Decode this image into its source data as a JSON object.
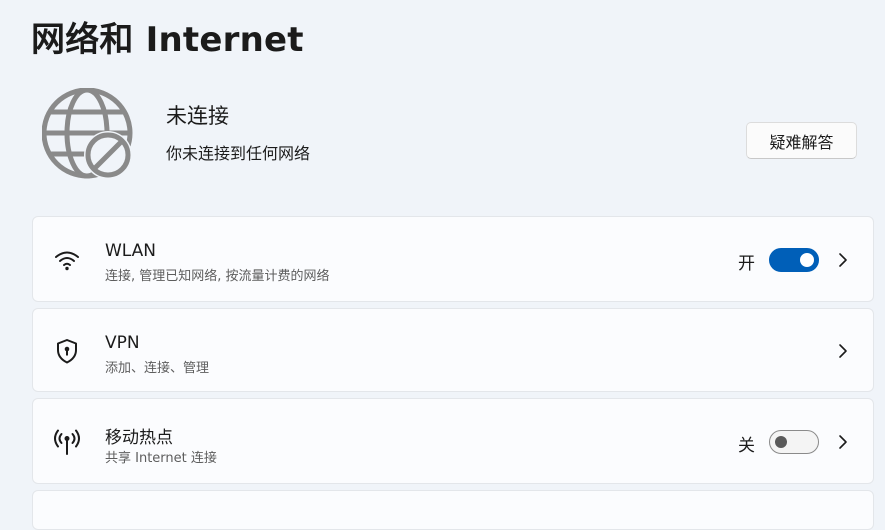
{
  "page": {
    "title": "网络和 Internet"
  },
  "status": {
    "title": "未连接",
    "subtitle": "你未连接到任何网络",
    "troubleshoot_label": "疑难解答",
    "icon": "globe-disconnected-icon"
  },
  "cards": {
    "wlan": {
      "title": "WLAN",
      "subtitle": "连接, 管理已知网络, 按流量计费的网络",
      "toggle_label": "开",
      "toggle_on": true,
      "icon": "wifi-icon"
    },
    "vpn": {
      "title": "VPN",
      "subtitle": "添加、连接、管理",
      "icon": "shield-icon"
    },
    "hotspot": {
      "title": "移动热点",
      "subtitle": "共享 Internet 连接",
      "toggle_label": "关",
      "toggle_on": false,
      "icon": "hotspot-icon"
    }
  },
  "colors": {
    "accent": "#005fb8",
    "background": "#f0f4f9",
    "card": "#fbfcfe"
  }
}
